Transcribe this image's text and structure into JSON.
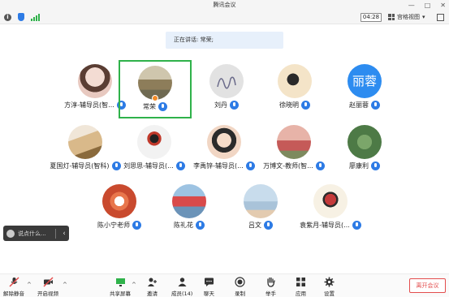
{
  "window": {
    "title": "腾讯会议"
  },
  "topbar": {
    "timer": "04:28",
    "view_label": "宫格视图"
  },
  "banner": {
    "speaking_text": "正在讲话: 常荣;"
  },
  "participants": [
    {
      "name": "方淳-辅导员(智...",
      "avatar_color": "#e8c9c0"
    },
    {
      "name": "常荣",
      "avatar_color": "#b7a98c",
      "active": true
    },
    {
      "name": "刘丹",
      "avatar_color": "#d9d9d9"
    },
    {
      "name": "徐晓明",
      "avatar_color": "#f4e4c8"
    },
    {
      "name": "赵丽蓉",
      "avatar_text": "丽蓉",
      "avatar_color": "#2d8cf0"
    },
    {
      "name": "夏国灯-辅导员(智科)",
      "avatar_color": "#d9b98a"
    },
    {
      "name": "刘思思-辅导员(...",
      "avatar_color": "#f2f2f2"
    },
    {
      "name": "李禹锌-辅导员(...",
      "avatar_color": "#f1d6c4"
    },
    {
      "name": "万博文-教师(智...",
      "avatar_color": "#c55a58"
    },
    {
      "name": "廖康利",
      "avatar_color": "#4d7a46"
    },
    {
      "name": "陈小宁老师",
      "avatar_color": "#e8764c"
    },
    {
      "name": "陈礼花",
      "avatar_color": "#6b93b8"
    },
    {
      "name": "吕文",
      "avatar_color": "#a9c3d9"
    },
    {
      "name": "袁紫月-辅导员(...",
      "avatar_color": "#c43a3a"
    }
  ],
  "chat": {
    "placeholder": "说点什么..."
  },
  "toolbar": {
    "mute": "解除静音",
    "video": "开启视频",
    "share": "共享屏幕",
    "invite": "邀请",
    "members": "成员(14)",
    "chat": "聊天",
    "record": "录制",
    "raise_hand": "举手",
    "apps": "应用",
    "settings": "设置",
    "leave": "离开会议"
  },
  "colors": {
    "accent": "#2d7be5",
    "active_border": "#2fb24a",
    "danger": "#e34d4d"
  }
}
